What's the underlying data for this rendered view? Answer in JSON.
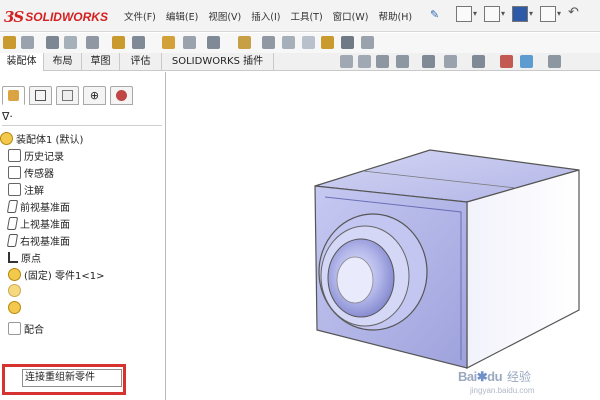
{
  "app": {
    "brand": "SOLIDWORKS",
    "accent_color": "#d42020"
  },
  "menu": {
    "items": [
      "文件(F)",
      "编辑(E)",
      "视图(V)",
      "插入(I)",
      "工具(T)",
      "窗口(W)",
      "帮助(H)"
    ]
  },
  "icons": {
    "pin": "pin-icon",
    "quick_access": [
      "new-document-icon",
      "open-icon",
      "save-icon",
      "print-icon",
      "undo-icon"
    ]
  },
  "command_tabs": [
    "装配体",
    "布局",
    "草图",
    "评估",
    "SOLIDWORKS 插件"
  ],
  "active_tab": "装配体",
  "panel": {
    "tab_icons": [
      "feature-manager-icon",
      "property-manager-icon",
      "configuration-manager-icon",
      "dimxpert-icon",
      "display-manager-icon"
    ],
    "filter_icon": "filter-icon"
  },
  "tree": {
    "items": [
      {
        "label": "装配体1 (默认)",
        "icon": "assembly-icon"
      },
      {
        "label": "历史记录",
        "icon": "history-icon"
      },
      {
        "label": "传感器",
        "icon": "sensor-icon"
      },
      {
        "label": "注解",
        "icon": "annotation-icon"
      },
      {
        "label": "前视基准面",
        "icon": "plane-icon"
      },
      {
        "label": "上视基准面",
        "icon": "plane-icon"
      },
      {
        "label": "右视基准面",
        "icon": "plane-icon"
      },
      {
        "label": "原点",
        "icon": "origin-icon"
      },
      {
        "label": "(固定) 零件1<1>",
        "icon": "part-icon"
      },
      {
        "label": "连接重组新零件",
        "icon": "part-icon"
      },
      {
        "label": "配合",
        "icon": "mates-icon"
      }
    ],
    "editing_item": "连接重组新零件"
  },
  "watermark": {
    "brand": "Bai",
    "brand_suffix": "du",
    "text": "经验",
    "url": "jingyan.baidu.com"
  },
  "highlight_color": "#d6322f"
}
